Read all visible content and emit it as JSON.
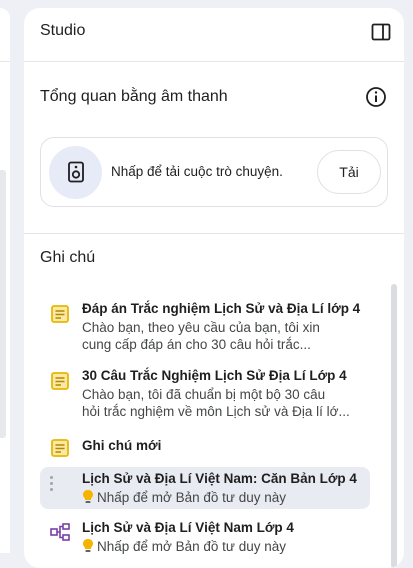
{
  "studio": {
    "title": "Studio"
  },
  "audio_overview": {
    "title": "Tổng quan bằng âm thanh",
    "prompt": "Nhấp để tải cuộc trò chuyện.",
    "load_label": "Tải"
  },
  "notes": {
    "title": "Ghi chú",
    "items": [
      {
        "title": "Đáp án Trắc nghiệm Lịch Sử và Địa Lí lớp 4",
        "line1": "Chào bạn, theo yêu cầu của bạn, tôi xin",
        "line2": "cung cấp đáp án cho 30 câu hỏi trắc..."
      },
      {
        "title": "30 Câu Trắc Nghiệm Lịch Sử Địa Lí Lớp 4",
        "line1": "Chào bạn, tôi đã chuẩn bị một bộ 30 câu",
        "line2": "hỏi trắc nghiệm về môn Lịch sử và Địa lí lớ..."
      },
      {
        "title": "Ghi chú mới"
      },
      {
        "title": "Lịch Sử và Địa Lí Việt Nam: Căn Bản Lớp 4",
        "hint": "Nhấp để mở Bản đồ tư duy này"
      },
      {
        "title": "Lịch Sử và Địa Lí Việt Nam Lớp 4",
        "hint": "Nhấp để mở Bản đồ tư duy này"
      }
    ]
  },
  "icons": {
    "note": "note-icon",
    "mindmap": "mind-map-icon",
    "bulb": "lightbulb-icon",
    "info": "info-icon",
    "speaker": "speaker-icon",
    "collapse": "collapse-panel-icon"
  },
  "colors": {
    "note_icon": "#e6b800",
    "mindmap_icon": "#7b3fa6",
    "bulb": "#f4b400",
    "highlight": "#e9ebf3"
  }
}
